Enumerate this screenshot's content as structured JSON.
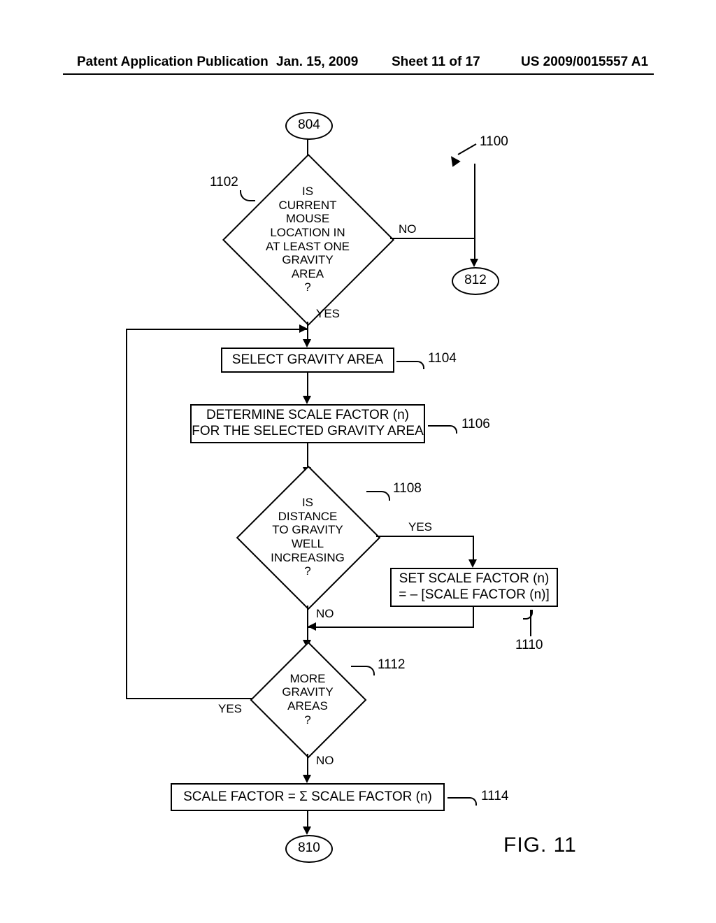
{
  "header": {
    "left": "Patent Application Publication",
    "date": "Jan. 15, 2009",
    "sheet": "Sheet 11 of 17",
    "right": "US 2009/0015557 A1"
  },
  "terminators": {
    "start": "804",
    "exit_no": "812",
    "end": "810"
  },
  "decisions": {
    "d1102": "IS\nCURRENT\nMOUSE\nLOCATION IN\nAT LEAST ONE\nGRAVITY\nAREA\n?",
    "d1108": "IS\nDISTANCE\nTO GRAVITY\nWELL\nINCREASING\n?",
    "d1112": "MORE\nGRAVITY\nAREAS\n?"
  },
  "processes": {
    "p1104": "SELECT GRAVITY AREA",
    "p1106": "DETERMINE SCALE FACTOR (n)\nFOR THE SELECTED GRAVITY AREA",
    "p1110": "SET SCALE FACTOR (n)\n= – [SCALE FACTOR (n)]",
    "p1114": "SCALE FACTOR = Σ SCALE FACTOR (n)"
  },
  "labels": {
    "ref1100": "1100",
    "ref1102": "1102",
    "ref1104": "1104",
    "ref1106": "1106",
    "ref1108": "1108",
    "ref1110": "1110",
    "ref1112": "1112",
    "ref1114": "1114",
    "yes": "YES",
    "no": "NO",
    "fig": "FIG. 11"
  }
}
